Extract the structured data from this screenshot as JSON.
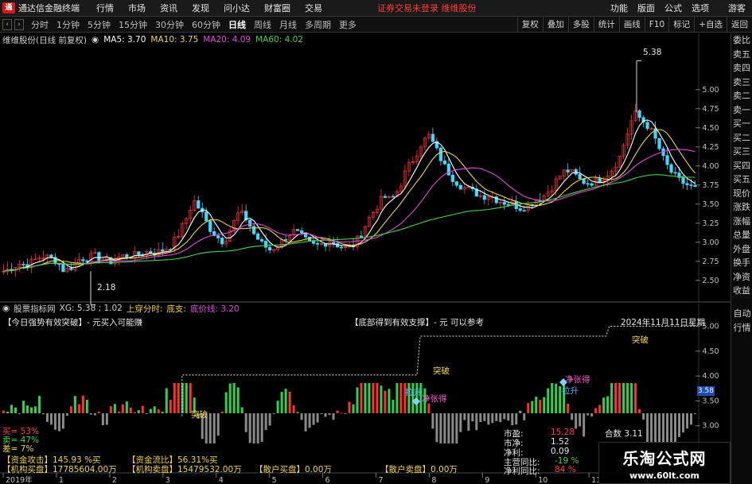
{
  "app": {
    "logo": "通",
    "title": "通达信金融终端",
    "warning": "证券交易未登录  维维股份",
    "guest": "游客"
  },
  "menu": {
    "left": [
      "行情",
      "市场",
      "资讯",
      "发现",
      "问小达",
      "财富圈",
      "交易"
    ],
    "right": [
      "功能",
      "版面",
      "公式",
      "选项"
    ]
  },
  "toolbar": {
    "periods": [
      "分时",
      "1分钟",
      "5分钟",
      "15分钟",
      "30分钟",
      "60分钟",
      "日线",
      "周线",
      "月线",
      "多周期",
      "更多"
    ],
    "active": "日线",
    "right": [
      "复权",
      "叠加",
      "多股",
      "统计",
      "画线",
      "F10",
      "标记",
      "+自选",
      "返回"
    ]
  },
  "side_tabs": {
    "top": [
      "委比",
      "卖五",
      "卖四",
      "卖三",
      "卖二",
      "卖一",
      "买一",
      "买二",
      "买三",
      "买四",
      "买五",
      "现价",
      "涨跌",
      "涨幅",
      "总量",
      "外盘",
      "换手",
      "净资",
      "收益"
    ],
    "bottom": [
      "自动",
      "行情"
    ]
  },
  "main_legend": {
    "name": "维维股份(日线 前复权)",
    "ma5": "MA5: 3.70",
    "ma10": "MA10: 3.75",
    "ma20": "MA20: 4.09",
    "ma60": "MA60: 4.02"
  },
  "indicator_legend": {
    "name": "股票指标网",
    "xg": "XG: 5.38 ; 1.02",
    "item1": "上穿分时:",
    "item2": "底支:",
    "item3": "底价线: 3.20"
  },
  "annotations": {
    "high_label": "5.38",
    "low_label": "2.18",
    "ind_text1": "【今日强势有效突破】- 元买入可能赚",
    "ind_text2": "【底部得到有效支撑】- 元 可以参考",
    "ind_date": "2024年11月11日星期",
    "tupo": "突破",
    "lasheng": "拉升",
    "jingzhang": "净张得",
    "price_tag": "3.58"
  },
  "stats_left": {
    "lines": [
      "买= 53%",
      "卖= 47%",
      "差= 7%"
    ]
  },
  "fund_boxes": {
    "b1": "【资金攻击】145.93 %买",
    "b2": "【资金流比】56.31%买",
    "b3": "【机构买盘】17785604.00万",
    "b4": "【机构卖盘】15479532.00万",
    "b5": "【散户买盘】0.00万",
    "b6": "【散户卖盘】0.00万"
  },
  "fund_mid": {
    "lines": [
      "市盈:",
      "市净:",
      "净利:",
      "主营同比:",
      "净利同比:"
    ],
    "values": [
      "15.28",
      "1.52",
      "0.09",
      "-19 %",
      "84 %"
    ],
    "extra": "合数 3.11"
  },
  "date_axis": {
    "labels": [
      "2019年",
      "1",
      "2",
      "3",
      "4",
      "5",
      "6",
      "7",
      "8",
      "9",
      "10",
      "11",
      "1"
    ]
  },
  "watermark": {
    "title": "乐淘公式网",
    "url": "www.60lt.com"
  },
  "chart_data": [
    {
      "type": "candlestick",
      "title": "维维股份(日线 前复权)",
      "yticks": [
        2.5,
        2.75,
        3.0,
        3.25,
        3.5,
        3.75,
        4.0,
        4.25,
        4.5,
        4.75,
        5.0
      ],
      "ylim": [
        2.3,
        5.55
      ],
      "annotated_high": 5.38,
      "annotated_low": 2.18,
      "series": [
        {
          "name": "MA5",
          "color": "#ffffff",
          "last": 3.7
        },
        {
          "name": "MA10",
          "color": "#f2d34a",
          "last": 3.75
        },
        {
          "name": "MA20",
          "color": "#e04ae0",
          "last": 4.09
        },
        {
          "name": "MA60",
          "color": "#47d147",
          "last": 4.02
        }
      ],
      "close_path": [
        2.62,
        2.66,
        2.72,
        2.7,
        2.76,
        2.82,
        2.8,
        2.75,
        2.62,
        2.68,
        2.78,
        2.8,
        2.82,
        2.78,
        2.74,
        2.8,
        2.83,
        2.82,
        2.85,
        2.88,
        2.86,
        2.9,
        2.95,
        3.1,
        3.3,
        3.55,
        3.4,
        3.2,
        3.08,
        3.0,
        3.2,
        3.4,
        3.3,
        3.1,
        2.98,
        2.9,
        2.95,
        3.05,
        3.15,
        3.1,
        3.0,
        2.95,
        2.98,
        3.02,
        2.96,
        2.92,
        2.96,
        3.1,
        3.3,
        3.45,
        3.6,
        3.55,
        3.7,
        3.95,
        4.1,
        4.3,
        4.4,
        4.2,
        4.0,
        3.85,
        3.75,
        3.7,
        3.65,
        3.6,
        3.62,
        3.55,
        3.52,
        3.5,
        3.45,
        3.48,
        3.55,
        3.6,
        3.7,
        3.85,
        3.95,
        3.9,
        3.8,
        3.78,
        3.8,
        3.85,
        3.95,
        4.1,
        4.4,
        4.7,
        4.6,
        4.5,
        4.3,
        4.05,
        3.9,
        3.8,
        3.75,
        3.7
      ]
    },
    {
      "type": "bar",
      "title": "股票指标网",
      "yticks": [
        3.0,
        3.5,
        4.0,
        4.5,
        5.0
      ],
      "ylim": [
        2.9,
        5.2
      ],
      "step_line": [
        {
          "from": 0.26,
          "level": 4.02
        },
        {
          "from": 0.6,
          "level": 4.8
        },
        {
          "from": 0.87,
          "level": 5.0
        }
      ],
      "signals": [
        "突破",
        "拉升",
        "净张得"
      ]
    }
  ]
}
